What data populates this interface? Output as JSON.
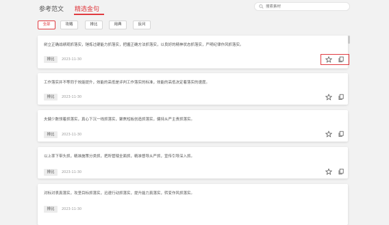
{
  "tabs": [
    {
      "label": "参考范文",
      "active": false
    },
    {
      "label": "精选金句",
      "active": true
    }
  ],
  "search": {
    "placeholder": "搜索素材"
  },
  "filters": [
    "全部",
    "攻略",
    "排比",
    "用典",
    "反问"
  ],
  "active_filter": "全部",
  "cards": [
    {
      "text": "树立正确战绩观抓落实，锤炼过硬能力抓落实，把握正确方法抓落实，以良好的精神状态抓落实，严明纪律作风抓落实。",
      "tag": "排比",
      "date": "2023-11-30",
      "actions_highlighted": true
    },
    {
      "text": "工作落实并不等同于效能提升，效能的高低是评判工作落实的标准，效能的高低决定着落实的速度。",
      "tag": "排比",
      "date": "2023-11-30",
      "actions_highlighted": false
    },
    {
      "text": "夫健少数领着抓落实，真心下沉一线抓落实，聚焦短板创造抓落实，健持从严主责抓落实。",
      "tag": "排比",
      "date": "2023-11-30",
      "actions_highlighted": false
    },
    {
      "text": "以上率下带头抓，精准施策分类抓，把所管辖全面抓，精准督导从严抓，宣传引导深入抓。",
      "tag": "排比",
      "date": "2023-11-30",
      "actions_highlighted": false
    },
    {
      "text": "对标对表真落实，攻坚目标抓落实，迅速行动抓落实，提升能力真落实，转变作风抓落实。",
      "tag": "排比",
      "date": "2023-11-30",
      "actions_highlighted": false
    }
  ],
  "colors": {
    "accent": "#e0393e",
    "background": "#f2f2f2",
    "card": "#ffffff"
  },
  "icons": {
    "search": "search-icon",
    "favorite": "star-icon",
    "copy": "copy-icon"
  }
}
